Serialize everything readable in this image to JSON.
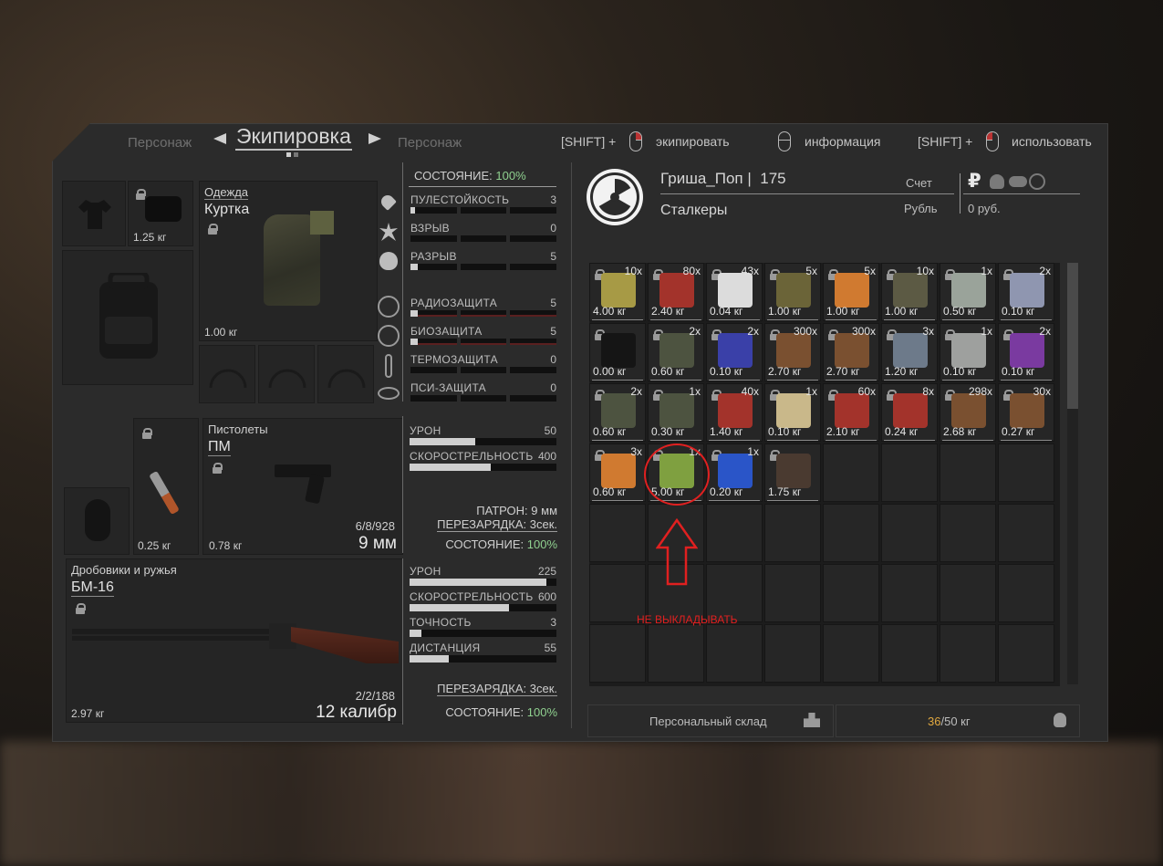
{
  "header": {
    "tab_left": "Персонаж",
    "tab_active": "Экипировка",
    "tab_right": "Персонаж",
    "hint_equip_key": "[SHIFT] +",
    "hint_equip": "экипировать",
    "hint_info": "информация",
    "hint_use_key": "[SHIFT] +",
    "hint_use": "использовать"
  },
  "equipment": {
    "slot_small_weight": "1.25 кг",
    "clothing": {
      "category": "Одежда",
      "name": "Куртка",
      "weight": "1.00 кг"
    },
    "status_label": "СОСТОЯНИЕ:",
    "status_value": "100%",
    "stats": [
      {
        "label": "ПУЛЕСТОЙКОСТЬ",
        "value": "3",
        "fill": 0.02
      },
      {
        "label": "ВЗРЫВ",
        "value": "0",
        "fill": 0
      },
      {
        "label": "РАЗРЫВ",
        "value": "5",
        "fill": 0.05
      },
      {
        "label": "РАДИОЗАЩИТА",
        "value": "5",
        "fill": 0.05
      },
      {
        "label": "БИОЗАЩИТА",
        "value": "5",
        "fill": 0.05
      },
      {
        "label": "ТЕРМОЗАЩИТА",
        "value": "0",
        "fill": 0
      },
      {
        "label": "ПСИ-ЗАЩИТА",
        "value": "0",
        "fill": 0
      }
    ],
    "knife_weight": "0.25 кг",
    "pistol": {
      "category": "Пистолеты",
      "name": "ПМ",
      "weight": "0.78 кг",
      "ammo": "6/8/928",
      "caliber": "9 мм",
      "stats": [
        {
          "label": "УРОН",
          "value": "50",
          "fill": 0.45
        },
        {
          "label": "СКОРОСТРЕЛЬНОСТЬ",
          "value": "400",
          "fill": 0.55
        }
      ],
      "cartridge": "ПАТРОН: 9 мм",
      "reload": "ПЕРЕЗАРЯДКА: 3сек.",
      "status_label": "СОСТОЯНИЕ:",
      "status_value": "100%"
    },
    "shotgun": {
      "category": "Дробовики и ружья",
      "name": "БМ-16",
      "weight": "2.97 кг",
      "ammo": "2/2/188",
      "caliber": "12 калибр",
      "stats": [
        {
          "label": "УРОН",
          "value": "225",
          "fill": 0.93
        },
        {
          "label": "СКОРОСТРЕЛЬНОСТЬ",
          "value": "600",
          "fill": 0.68
        },
        {
          "label": "ТОЧНОСТЬ",
          "value": "3",
          "fill": 0.08
        },
        {
          "label": "ДИСТАНЦИЯ",
          "value": "55",
          "fill": 0.27
        }
      ],
      "reload": "ПЕРЕЗАРЯДКА: 3сек.",
      "status_label": "СОСТОЯНИЕ:",
      "status_value": "100%"
    }
  },
  "profile": {
    "name": "Гриша_Поп",
    "sep": "|",
    "level": "175",
    "faction": "Сталкеры",
    "account_label": "Счет",
    "currency_label": "Рубль",
    "balance": "0 руб.",
    "currency_symbol": "₽"
  },
  "inventory": {
    "items": [
      {
        "q": "10x",
        "w": "4.00 кг",
        "c": "#a79a45"
      },
      {
        "q": "80x",
        "w": "2.40 кг",
        "c": "#a3332b"
      },
      {
        "q": "43x",
        "w": "0.04 кг",
        "c": "#dcdcdc"
      },
      {
        "q": "5x",
        "w": "1.00 кг",
        "c": "#6b6438"
      },
      {
        "q": "5x",
        "w": "1.00 кг",
        "c": "#d07a30"
      },
      {
        "q": "10x",
        "w": "1.00 кг",
        "c": "#5c5a44"
      },
      {
        "q": "1x",
        "w": "0.50 кг",
        "c": "#9aa39a"
      },
      {
        "q": "2x",
        "w": "0.10 кг",
        "c": "#8f96b0"
      },
      {
        "q": "",
        "w": "0.00 кг",
        "c": "#151515"
      },
      {
        "q": "2x",
        "w": "0.60 кг",
        "c": "#4d5340"
      },
      {
        "q": "2x",
        "w": "0.10 кг",
        "c": "#3a40a8"
      },
      {
        "q": "300x",
        "w": "2.70 кг",
        "c": "#7a5030"
      },
      {
        "q": "300x",
        "w": "2.70 кг",
        "c": "#7a5030"
      },
      {
        "q": "3x",
        "w": "1.20 кг",
        "c": "#6d7a8a"
      },
      {
        "q": "1x",
        "w": "0.10 кг",
        "c": "#9ea09e"
      },
      {
        "q": "2x",
        "w": "0.10 кг",
        "c": "#7a3aa0"
      },
      {
        "q": "2x",
        "w": "0.60 кг",
        "c": "#4d5340"
      },
      {
        "q": "1x",
        "w": "0.30 кг",
        "c": "#4d5340"
      },
      {
        "q": "40x",
        "w": "1.40 кг",
        "c": "#a3332b"
      },
      {
        "q": "1x",
        "w": "0.10 кг",
        "c": "#c9b88a"
      },
      {
        "q": "60x",
        "w": "2.10 кг",
        "c": "#a3332b"
      },
      {
        "q": "8x",
        "w": "0.24 кг",
        "c": "#a3332b"
      },
      {
        "q": "298x",
        "w": "2.68 кг",
        "c": "#7a5030"
      },
      {
        "q": "30x",
        "w": "0.27 кг",
        "c": "#7a5030"
      },
      {
        "q": "3x",
        "w": "0.60 кг",
        "c": "#d07a30"
      },
      {
        "q": "1x",
        "w": "5.00 кг",
        "c": "#7fa040"
      },
      {
        "q": "1x",
        "w": "0.20 кг",
        "c": "#2a55c8"
      },
      {
        "q": "",
        "w": "1.75 кг",
        "c": "#4a3a30"
      }
    ],
    "storage_label": "Персональный склад",
    "weight_current": "36",
    "weight_sep": "/",
    "weight_max": "50 кг"
  },
  "annotation": {
    "text": "НЕ ВЫКЛАДЫВАТЬ"
  }
}
